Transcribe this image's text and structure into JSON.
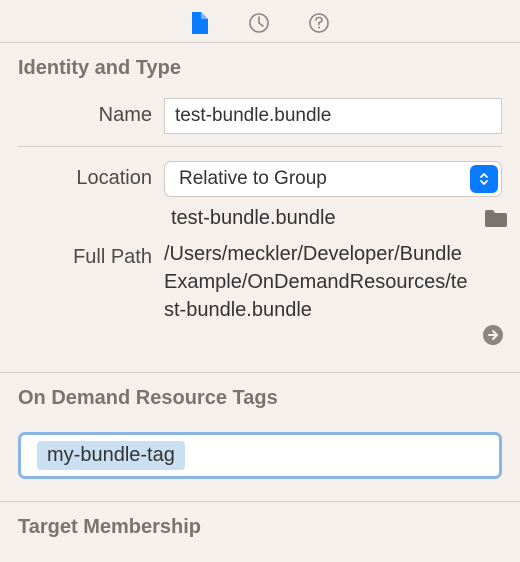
{
  "tabs": {
    "file_active": true
  },
  "identity": {
    "section_title": "Identity and Type",
    "name_label": "Name",
    "name_value": "test-bundle.bundle",
    "location_label": "Location",
    "location_value": "Relative to Group",
    "location_filename": "test-bundle.bundle",
    "fullpath_label": "Full Path",
    "fullpath_value": "/Users/meckler/Developer/BundleExample/OnDemandResources/test-bundle.bundle"
  },
  "resource_tags": {
    "section_title": "On Demand Resource Tags",
    "tags": [
      "my-bundle-tag"
    ]
  },
  "target_membership": {
    "section_title": "Target Membership"
  }
}
